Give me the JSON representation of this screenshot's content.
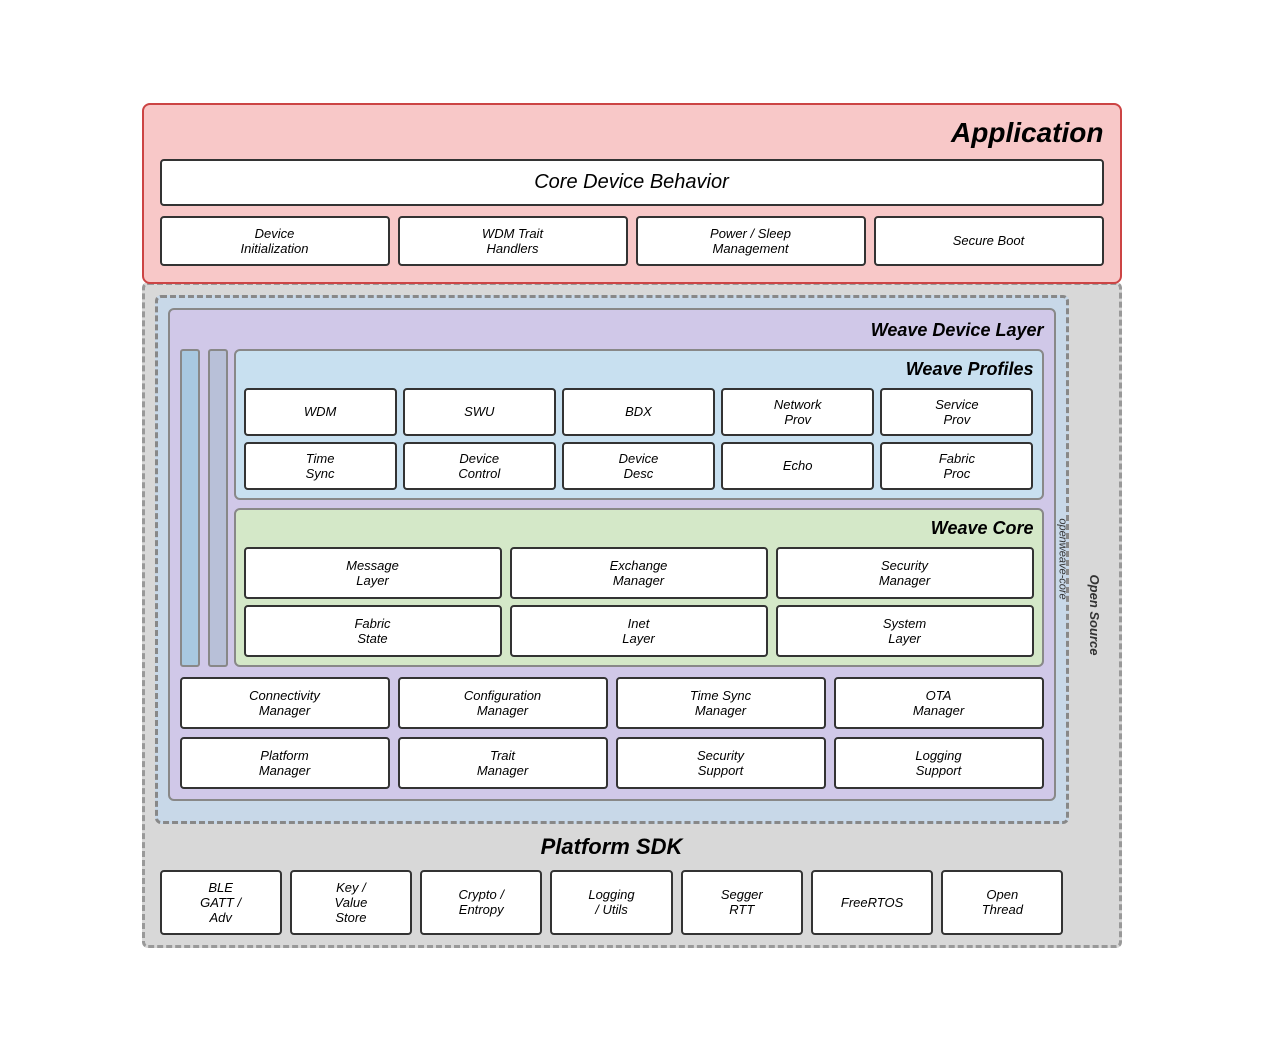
{
  "app": {
    "title": "Application",
    "core_device_behavior": "Core Device Behavior",
    "sub_boxes": [
      "Device\nInitialization",
      "WDM Trait\nHandlers",
      "Power / Sleep\nManagement",
      "Secure Boot"
    ]
  },
  "weave_profiles": {
    "title": "Weave Profiles",
    "row1": [
      "WDM",
      "SWU",
      "BDX",
      "Network\nProv",
      "Service\nProv"
    ],
    "row2": [
      "Time\nSync",
      "Device\nControl",
      "Device\nDesc",
      "Echo",
      "Fabric\nProc"
    ]
  },
  "weave_core": {
    "title": "Weave Core",
    "row1": [
      "Message\nLayer",
      "Exchange\nManager",
      "Security\nManager"
    ],
    "row2": [
      "Fabric\nState",
      "Inet\nLayer",
      "System\nLayer"
    ]
  },
  "weave_device_layer": {
    "title": "Weave Device Layer",
    "row1": [
      "Connectivity\nManager",
      "Configuration\nManager",
      "Time Sync\nManager",
      "OTA\nManager"
    ],
    "row2": [
      "Platform\nManager",
      "Trait\nManager",
      "Security\nSupport",
      "Logging\nSupport"
    ]
  },
  "platform_sdk": {
    "title": "Platform SDK",
    "boxes": [
      "BLE\nGATT /\nAdv",
      "Key /\nValue\nStore",
      "Crypto /\nEntropy",
      "Logging\n/ Utils",
      "Segger\nRTT",
      "FreeRTOS",
      "Open\nThread"
    ]
  },
  "labels": {
    "openweave_core": "openweave-core",
    "open_source": "Open Source"
  }
}
